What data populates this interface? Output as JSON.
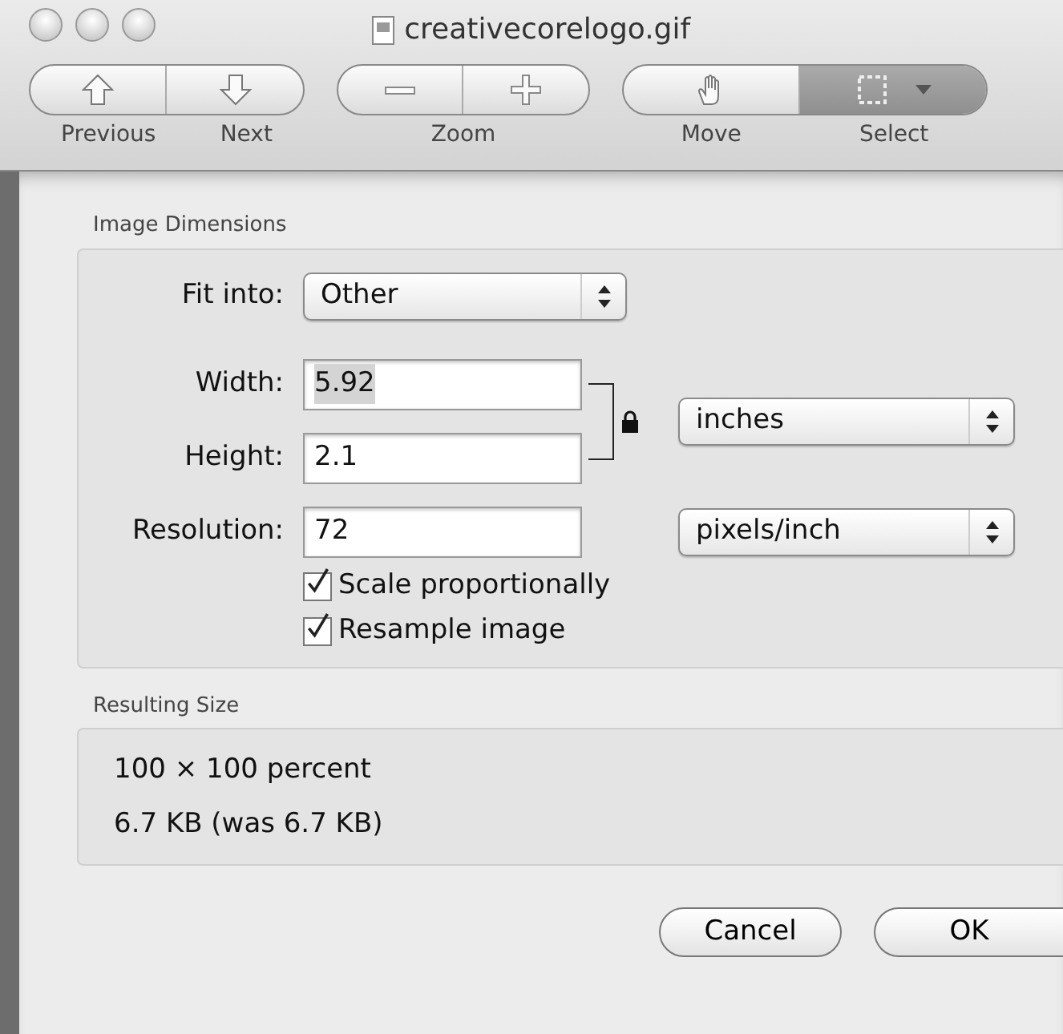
{
  "window": {
    "title": "creativecorelogo.gif"
  },
  "toolbar": [
    {
      "items": [
        {
          "kind": "up",
          "selected": false
        },
        {
          "kind": "down",
          "selected": false
        }
      ],
      "labels": [
        "Previous",
        "Next"
      ]
    },
    {
      "items": [
        {
          "kind": "minus",
          "selected": false
        },
        {
          "kind": "plus",
          "selected": false
        }
      ],
      "labels": [
        "Zoom"
      ]
    },
    {
      "items": [
        {
          "kind": "hand",
          "selected": false
        },
        {
          "kind": "marquee",
          "selected": true
        }
      ],
      "labels": [
        "Move",
        "Select"
      ]
    }
  ],
  "image_dimensions": {
    "title": "Image Dimensions",
    "fit_into": {
      "label": "Fit into:",
      "value": "Other"
    },
    "fields": [
      {
        "label": "Width:",
        "value": "5.92",
        "highlighted": true
      },
      {
        "label": "Height:",
        "value": "2.1",
        "highlighted": false
      },
      {
        "label": "Resolution:",
        "value": "72",
        "highlighted": false
      }
    ],
    "size_unit": "inches",
    "resolution_unit": "pixels/inch",
    "constrained": true,
    "checkboxes": [
      {
        "label": "Scale proportionally",
        "checked": true
      },
      {
        "label": "Resample image",
        "checked": true
      }
    ]
  },
  "resulting_size": {
    "title": "Resulting Size",
    "lines": [
      "100 × 100 percent",
      "6.7 KB (was 6.7 KB)"
    ]
  },
  "buttons": [
    "Cancel",
    "OK"
  ]
}
